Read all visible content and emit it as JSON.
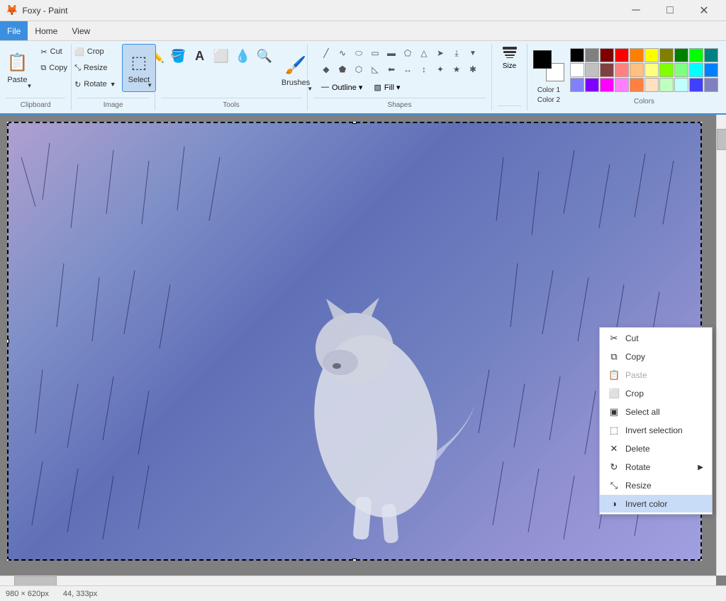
{
  "titleBar": {
    "title": "Foxy - Paint",
    "buttons": {
      "minimize": "─",
      "maximize": "□",
      "close": "✕"
    }
  },
  "menuBar": {
    "items": [
      "File",
      "Home",
      "View"
    ]
  },
  "ribbon": {
    "clipboard": {
      "label": "Clipboard",
      "paste": "Paste",
      "cut": "Cut",
      "copy": "Copy"
    },
    "image": {
      "label": "Image",
      "crop": "Crop",
      "resize": "Resize",
      "rotate": "Rotate"
    },
    "tools": {
      "label": "Tools"
    },
    "select": {
      "label": "Select"
    },
    "shapes": {
      "label": "Shapes"
    },
    "outline": {
      "label": "Outline ▾"
    },
    "fill": {
      "label": "Fill ▾"
    },
    "brushes": {
      "label": "Brushes"
    },
    "size": {
      "label": "Size"
    },
    "color1": {
      "label": "Color 1"
    },
    "color2": {
      "label": "Color 2"
    },
    "colors": {
      "label": "Colors"
    }
  },
  "contextMenu": {
    "items": [
      {
        "id": "cut",
        "label": "Cut",
        "icon": "✂",
        "disabled": false,
        "hasSubmenu": false
      },
      {
        "id": "copy",
        "label": "Copy",
        "icon": "⧉",
        "disabled": false,
        "hasSubmenu": false
      },
      {
        "id": "paste",
        "label": "Paste",
        "icon": "📋",
        "disabled": true,
        "hasSubmenu": false
      },
      {
        "id": "crop",
        "label": "Crop",
        "icon": "⬜",
        "disabled": false,
        "hasSubmenu": false
      },
      {
        "id": "select-all",
        "label": "Select all",
        "icon": "▣",
        "disabled": false,
        "hasSubmenu": false
      },
      {
        "id": "invert-selection",
        "label": "Invert selection",
        "icon": "⬚",
        "disabled": false,
        "hasSubmenu": false
      },
      {
        "id": "delete",
        "label": "Delete",
        "icon": "✕",
        "disabled": false,
        "hasSubmenu": false
      },
      {
        "id": "rotate",
        "label": "Rotate",
        "icon": "↻",
        "disabled": false,
        "hasSubmenu": true
      },
      {
        "id": "resize",
        "label": "Resize",
        "icon": "⤡",
        "disabled": false,
        "hasSubmenu": false
      },
      {
        "id": "invert-color",
        "label": "Invert color",
        "icon": "◑",
        "disabled": false,
        "hasSubmenu": false
      }
    ]
  },
  "colors": {
    "color1": "#000000",
    "color2": "#ffffff",
    "palette": [
      "#000000",
      "#808080",
      "#800000",
      "#ff0000",
      "#ff8000",
      "#ffff00",
      "#808000",
      "#008000",
      "#00ff00",
      "#008080",
      "#ffffff",
      "#c0c0c0",
      "#804040",
      "#ff8080",
      "#ffc080",
      "#ffff80",
      "#80ff00",
      "#80ff80",
      "#00ffff",
      "#0080ff",
      "#8080ff",
      "#8000ff",
      "#ff00ff",
      "#ff80ff",
      "#ff8040",
      "#ffe0c0",
      "#c0ffc0",
      "#c0ffff",
      "#4040ff",
      "#8080c0"
    ]
  },
  "statusBar": {
    "dimensions": "980 × 620px",
    "position": "44, 333px"
  }
}
